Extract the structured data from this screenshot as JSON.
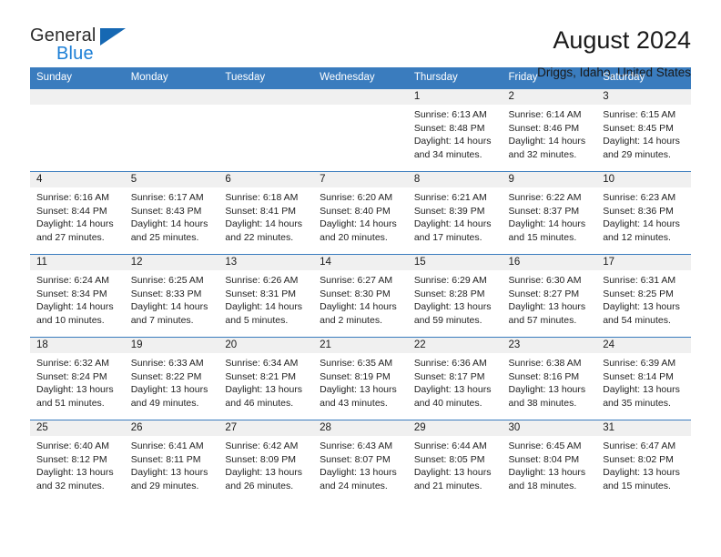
{
  "brand": {
    "word_one": "General",
    "word_two": "Blue",
    "logo_icon": "triangle-logo-icon",
    "accent_color": "#1668b3"
  },
  "header": {
    "title": "August 2024",
    "location": "Driggs, Idaho, United States"
  },
  "calendar": {
    "header_bg": "#3a7cbe",
    "day_band_bg": "#f0f0f0",
    "weekday_headers": [
      "Sunday",
      "Monday",
      "Tuesday",
      "Wednesday",
      "Thursday",
      "Friday",
      "Saturday"
    ],
    "weeks": [
      [
        {
          "day": ""
        },
        {
          "day": ""
        },
        {
          "day": ""
        },
        {
          "day": ""
        },
        {
          "day": "1",
          "sunrise": "Sunrise: 6:13 AM",
          "sunset": "Sunset: 8:48 PM",
          "daylight_line1": "Daylight: 14 hours",
          "daylight_line2": "and 34 minutes."
        },
        {
          "day": "2",
          "sunrise": "Sunrise: 6:14 AM",
          "sunset": "Sunset: 8:46 PM",
          "daylight_line1": "Daylight: 14 hours",
          "daylight_line2": "and 32 minutes."
        },
        {
          "day": "3",
          "sunrise": "Sunrise: 6:15 AM",
          "sunset": "Sunset: 8:45 PM",
          "daylight_line1": "Daylight: 14 hours",
          "daylight_line2": "and 29 minutes."
        }
      ],
      [
        {
          "day": "4",
          "sunrise": "Sunrise: 6:16 AM",
          "sunset": "Sunset: 8:44 PM",
          "daylight_line1": "Daylight: 14 hours",
          "daylight_line2": "and 27 minutes."
        },
        {
          "day": "5",
          "sunrise": "Sunrise: 6:17 AM",
          "sunset": "Sunset: 8:43 PM",
          "daylight_line1": "Daylight: 14 hours",
          "daylight_line2": "and 25 minutes."
        },
        {
          "day": "6",
          "sunrise": "Sunrise: 6:18 AM",
          "sunset": "Sunset: 8:41 PM",
          "daylight_line1": "Daylight: 14 hours",
          "daylight_line2": "and 22 minutes."
        },
        {
          "day": "7",
          "sunrise": "Sunrise: 6:20 AM",
          "sunset": "Sunset: 8:40 PM",
          "daylight_line1": "Daylight: 14 hours",
          "daylight_line2": "and 20 minutes."
        },
        {
          "day": "8",
          "sunrise": "Sunrise: 6:21 AM",
          "sunset": "Sunset: 8:39 PM",
          "daylight_line1": "Daylight: 14 hours",
          "daylight_line2": "and 17 minutes."
        },
        {
          "day": "9",
          "sunrise": "Sunrise: 6:22 AM",
          "sunset": "Sunset: 8:37 PM",
          "daylight_line1": "Daylight: 14 hours",
          "daylight_line2": "and 15 minutes."
        },
        {
          "day": "10",
          "sunrise": "Sunrise: 6:23 AM",
          "sunset": "Sunset: 8:36 PM",
          "daylight_line1": "Daylight: 14 hours",
          "daylight_line2": "and 12 minutes."
        }
      ],
      [
        {
          "day": "11",
          "sunrise": "Sunrise: 6:24 AM",
          "sunset": "Sunset: 8:34 PM",
          "daylight_line1": "Daylight: 14 hours",
          "daylight_line2": "and 10 minutes."
        },
        {
          "day": "12",
          "sunrise": "Sunrise: 6:25 AM",
          "sunset": "Sunset: 8:33 PM",
          "daylight_line1": "Daylight: 14 hours",
          "daylight_line2": "and 7 minutes."
        },
        {
          "day": "13",
          "sunrise": "Sunrise: 6:26 AM",
          "sunset": "Sunset: 8:31 PM",
          "daylight_line1": "Daylight: 14 hours",
          "daylight_line2": "and 5 minutes."
        },
        {
          "day": "14",
          "sunrise": "Sunrise: 6:27 AM",
          "sunset": "Sunset: 8:30 PM",
          "daylight_line1": "Daylight: 14 hours",
          "daylight_line2": "and 2 minutes."
        },
        {
          "day": "15",
          "sunrise": "Sunrise: 6:29 AM",
          "sunset": "Sunset: 8:28 PM",
          "daylight_line1": "Daylight: 13 hours",
          "daylight_line2": "and 59 minutes."
        },
        {
          "day": "16",
          "sunrise": "Sunrise: 6:30 AM",
          "sunset": "Sunset: 8:27 PM",
          "daylight_line1": "Daylight: 13 hours",
          "daylight_line2": "and 57 minutes."
        },
        {
          "day": "17",
          "sunrise": "Sunrise: 6:31 AM",
          "sunset": "Sunset: 8:25 PM",
          "daylight_line1": "Daylight: 13 hours",
          "daylight_line2": "and 54 minutes."
        }
      ],
      [
        {
          "day": "18",
          "sunrise": "Sunrise: 6:32 AM",
          "sunset": "Sunset: 8:24 PM",
          "daylight_line1": "Daylight: 13 hours",
          "daylight_line2": "and 51 minutes."
        },
        {
          "day": "19",
          "sunrise": "Sunrise: 6:33 AM",
          "sunset": "Sunset: 8:22 PM",
          "daylight_line1": "Daylight: 13 hours",
          "daylight_line2": "and 49 minutes."
        },
        {
          "day": "20",
          "sunrise": "Sunrise: 6:34 AM",
          "sunset": "Sunset: 8:21 PM",
          "daylight_line1": "Daylight: 13 hours",
          "daylight_line2": "and 46 minutes."
        },
        {
          "day": "21",
          "sunrise": "Sunrise: 6:35 AM",
          "sunset": "Sunset: 8:19 PM",
          "daylight_line1": "Daylight: 13 hours",
          "daylight_line2": "and 43 minutes."
        },
        {
          "day": "22",
          "sunrise": "Sunrise: 6:36 AM",
          "sunset": "Sunset: 8:17 PM",
          "daylight_line1": "Daylight: 13 hours",
          "daylight_line2": "and 40 minutes."
        },
        {
          "day": "23",
          "sunrise": "Sunrise: 6:38 AM",
          "sunset": "Sunset: 8:16 PM",
          "daylight_line1": "Daylight: 13 hours",
          "daylight_line2": "and 38 minutes."
        },
        {
          "day": "24",
          "sunrise": "Sunrise: 6:39 AM",
          "sunset": "Sunset: 8:14 PM",
          "daylight_line1": "Daylight: 13 hours",
          "daylight_line2": "and 35 minutes."
        }
      ],
      [
        {
          "day": "25",
          "sunrise": "Sunrise: 6:40 AM",
          "sunset": "Sunset: 8:12 PM",
          "daylight_line1": "Daylight: 13 hours",
          "daylight_line2": "and 32 minutes."
        },
        {
          "day": "26",
          "sunrise": "Sunrise: 6:41 AM",
          "sunset": "Sunset: 8:11 PM",
          "daylight_line1": "Daylight: 13 hours",
          "daylight_line2": "and 29 minutes."
        },
        {
          "day": "27",
          "sunrise": "Sunrise: 6:42 AM",
          "sunset": "Sunset: 8:09 PM",
          "daylight_line1": "Daylight: 13 hours",
          "daylight_line2": "and 26 minutes."
        },
        {
          "day": "28",
          "sunrise": "Sunrise: 6:43 AM",
          "sunset": "Sunset: 8:07 PM",
          "daylight_line1": "Daylight: 13 hours",
          "daylight_line2": "and 24 minutes."
        },
        {
          "day": "29",
          "sunrise": "Sunrise: 6:44 AM",
          "sunset": "Sunset: 8:05 PM",
          "daylight_line1": "Daylight: 13 hours",
          "daylight_line2": "and 21 minutes."
        },
        {
          "day": "30",
          "sunrise": "Sunrise: 6:45 AM",
          "sunset": "Sunset: 8:04 PM",
          "daylight_line1": "Daylight: 13 hours",
          "daylight_line2": "and 18 minutes."
        },
        {
          "day": "31",
          "sunrise": "Sunrise: 6:47 AM",
          "sunset": "Sunset: 8:02 PM",
          "daylight_line1": "Daylight: 13 hours",
          "daylight_line2": "and 15 minutes."
        }
      ]
    ]
  }
}
